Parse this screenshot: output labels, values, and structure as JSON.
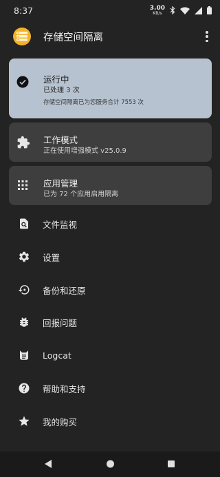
{
  "status_bar": {
    "time": "8:37",
    "net_speed_value": "3.00",
    "net_speed_unit": "KB/s",
    "icons": [
      "bluetooth-icon",
      "wifi-icon",
      "signal-icon",
      "battery-icon"
    ]
  },
  "app_bar": {
    "title": "存储空间隔离",
    "logo_icon": "app-logo-icon",
    "menu_icon": "more-vert-icon"
  },
  "cards": {
    "status": {
      "title": "运行中",
      "subtitle": "已处理 3 次",
      "note": "存储空间隔离已为您服务合计 7553 次",
      "icon": "check-circle-icon"
    },
    "mode": {
      "title": "工作模式",
      "subtitle": "正在使用增强模式 v25.0.9",
      "icon": "puzzle-icon"
    },
    "apps": {
      "title": "应用管理",
      "subtitle": "已为 72 个应用启用隔离",
      "icon": "apps-grid-icon"
    }
  },
  "menu": {
    "file_monitor": "文件监视",
    "settings": "设置",
    "backup_restore": "备份和还原",
    "report_issue": "回报问题",
    "logcat": "Logcat",
    "help_support": "帮助和支持",
    "purchases": "我的购买"
  },
  "colors": {
    "background": "#232323",
    "status_card": "#b6c2cf",
    "card": "#3e3e3e",
    "logo": "#f2b32b"
  }
}
